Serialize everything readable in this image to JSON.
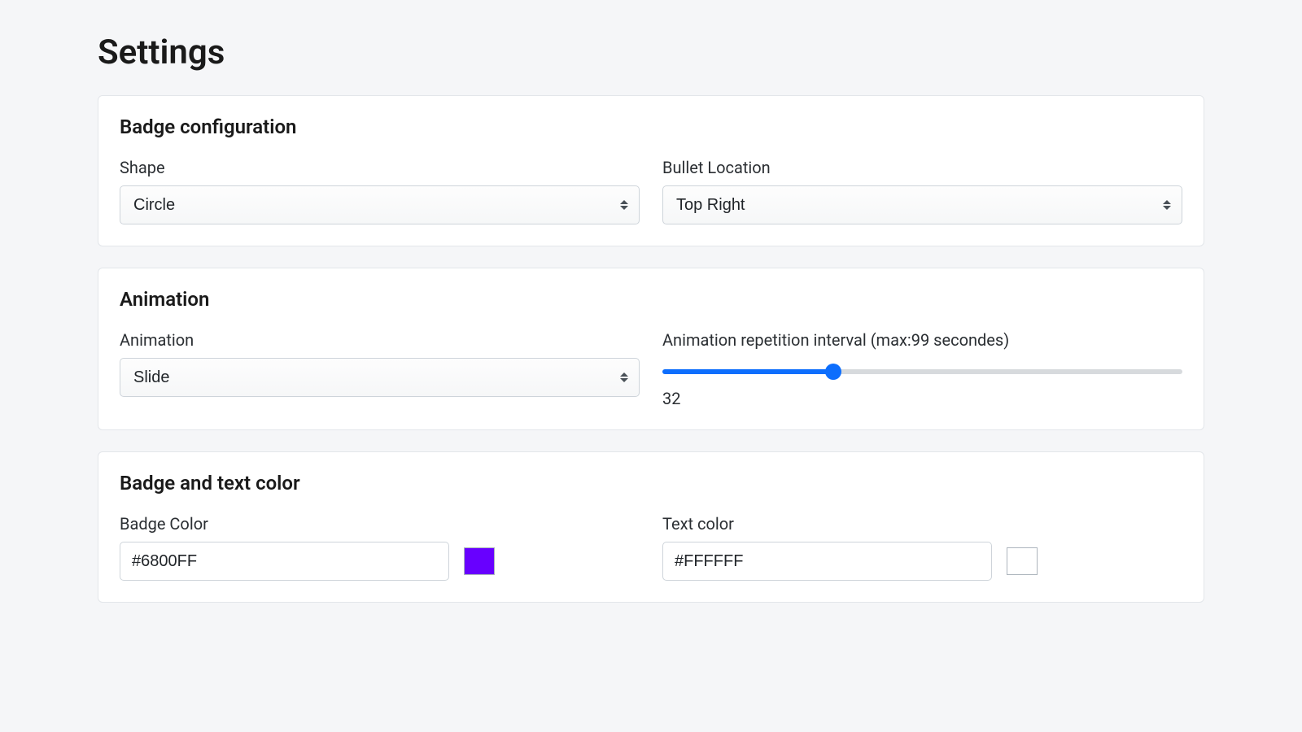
{
  "page": {
    "title": "Settings"
  },
  "badge_config": {
    "title": "Badge configuration",
    "shape": {
      "label": "Shape",
      "value": "Circle"
    },
    "bullet_location": {
      "label": "Bullet Location",
      "value": "Top Right"
    }
  },
  "animation": {
    "title": "Animation",
    "type": {
      "label": "Animation",
      "value": "Slide"
    },
    "interval": {
      "label": "Animation repetition interval (max:99 secondes)",
      "value": "32",
      "min": "0",
      "max": "99"
    }
  },
  "colors": {
    "title": "Badge and text color",
    "badge": {
      "label": "Badge Color",
      "value": "#6800FF",
      "swatch": "#6800FF"
    },
    "text": {
      "label": "Text color",
      "value": "#FFFFFF",
      "swatch": "#FFFFFF"
    }
  }
}
